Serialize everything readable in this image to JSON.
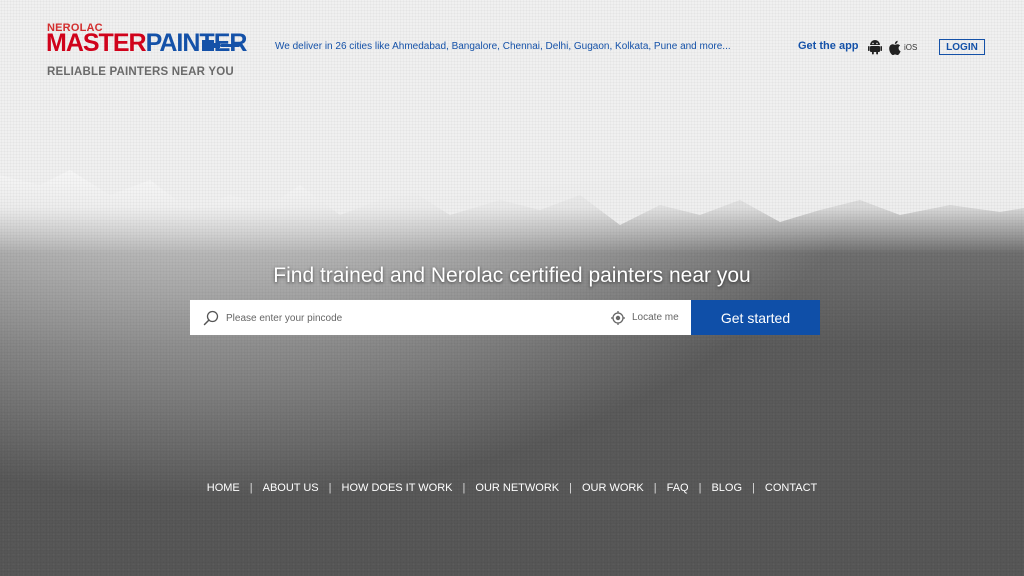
{
  "header": {
    "brand_top": "NEROLAC",
    "brand_master": "MASTER",
    "brand_painter": "PAINTER",
    "tagline": "RELIABLE PAINTERS NEAR YOU",
    "deliver_text": "We deliver in 26 cities like Ahmedabad, Bangalore, Chennai, Delhi, Gugaon, Kolkata, Pune and more...",
    "get_app_label": "Get the app",
    "ios_label": "iOS",
    "login_label": "LOGIN"
  },
  "hero": {
    "title": "Find trained and Nerolac certified painters near you",
    "pincode_placeholder": "Please enter your pincode",
    "locate_label": "Locate me",
    "cta_label": "Get started"
  },
  "footer_nav": {
    "items": [
      "HOME",
      "ABOUT US",
      "HOW DOES IT WORK",
      "OUR NETWORK",
      "OUR WORK",
      "FAQ",
      "BLOG",
      "CONTACT"
    ],
    "separator": "|"
  },
  "colors": {
    "brand_blue": "#1451a8",
    "brand_red": "#d0021b",
    "cta_blue": "#0f4fa8"
  },
  "icons": [
    "brush-icon",
    "android-icon",
    "apple-icon",
    "search-icon",
    "locate-icon"
  ]
}
